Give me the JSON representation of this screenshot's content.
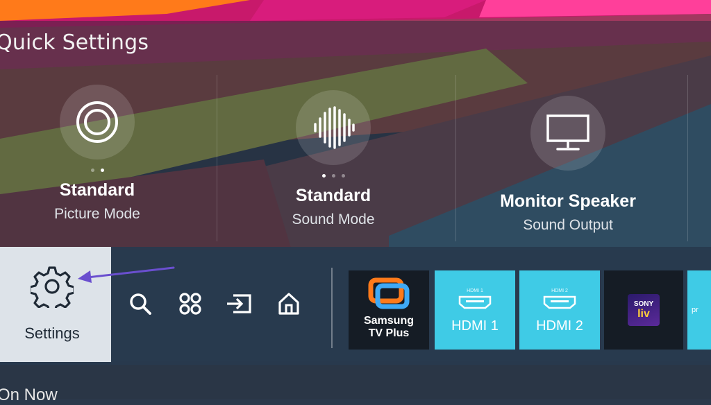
{
  "quick_settings": {
    "title": "Quick Settings",
    "tiles": [
      {
        "value": "Standard",
        "label": "Picture Mode",
        "icon": "picture-mode-icon",
        "dots": 2,
        "active_dot": 2
      },
      {
        "value": "Standard",
        "label": "Sound Mode",
        "icon": "sound-mode-icon",
        "dots": 3,
        "active_dot": 1
      },
      {
        "value": "Monitor Speaker",
        "label": "Sound Output",
        "icon": "monitor-icon",
        "dots": 0,
        "active_dot": 0
      }
    ]
  },
  "bar": {
    "settings_label": "Settings",
    "nav_icons": [
      "search-icon",
      "apps-icon",
      "source-icon",
      "home-icon"
    ],
    "apps": [
      {
        "name_line1": "Samsung",
        "name_line2": "TV Plus"
      },
      {
        "small": "HDMI 1",
        "name": "HDMI 1"
      },
      {
        "small": "HDMI 2",
        "name": "HDMI 2"
      },
      {
        "logo_top": "SONY",
        "logo_bottom": "liv"
      },
      {
        "name": "pr"
      }
    ]
  },
  "footer": {
    "on_now": "On Now"
  },
  "colors": {
    "accent_arrow": "#6a4fcf",
    "hdmi_tile": "#3fcbe6",
    "settings_tile": "#dde3e9"
  }
}
